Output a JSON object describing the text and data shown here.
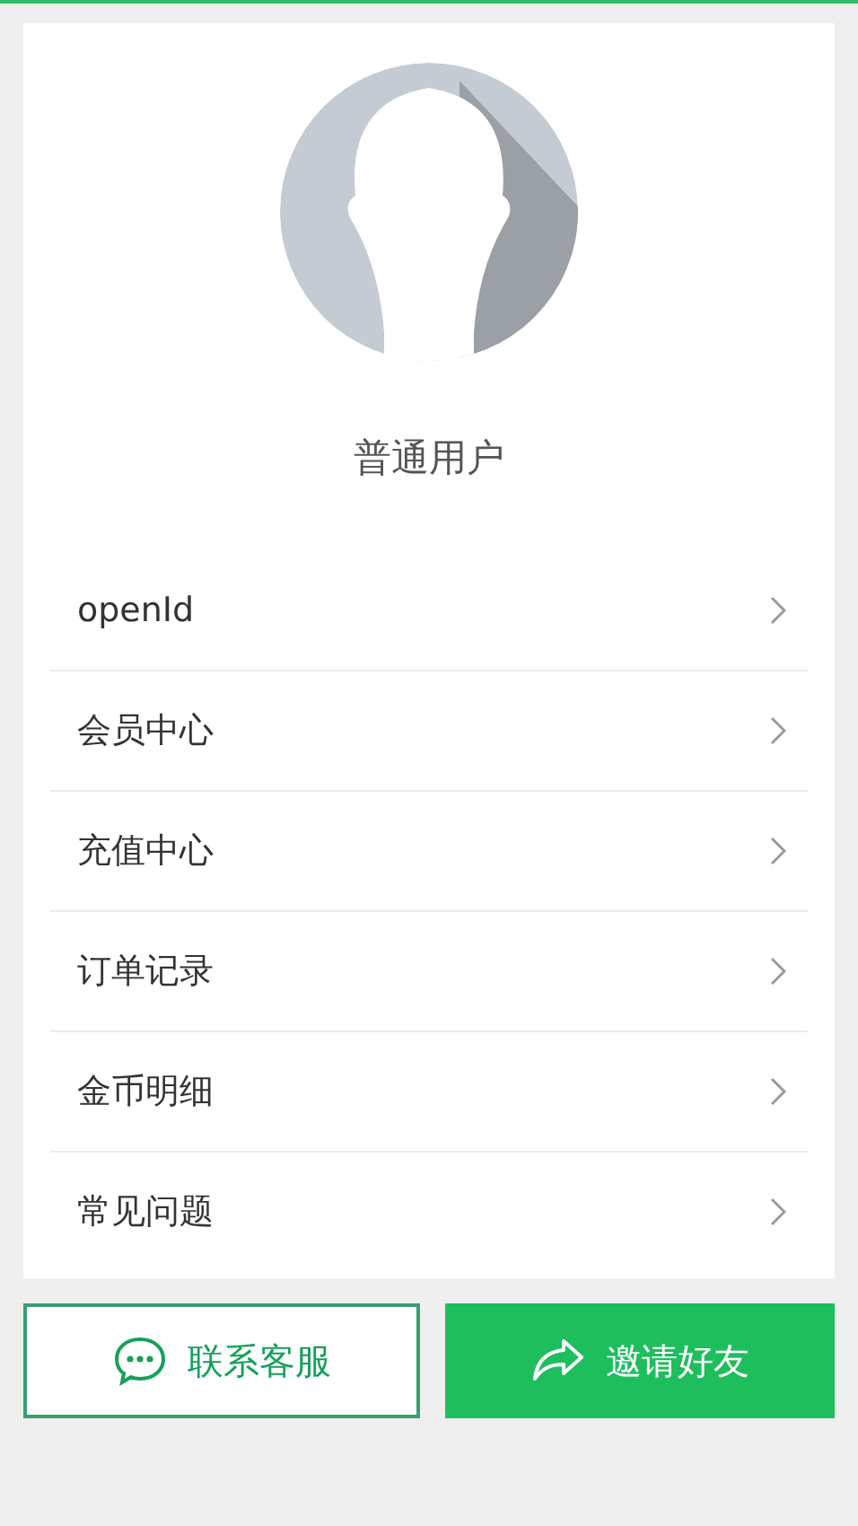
{
  "profile": {
    "name": "普通用户"
  },
  "menu": [
    {
      "label": "openId"
    },
    {
      "label": "会员中心"
    },
    {
      "label": "充值中心"
    },
    {
      "label": "订单记录"
    },
    {
      "label": "金币明细"
    },
    {
      "label": "常见问题"
    }
  ],
  "buttons": [
    {
      "label": "联系客服",
      "kind": "outline"
    },
    {
      "label": "邀请好友",
      "kind": "filled"
    }
  ]
}
